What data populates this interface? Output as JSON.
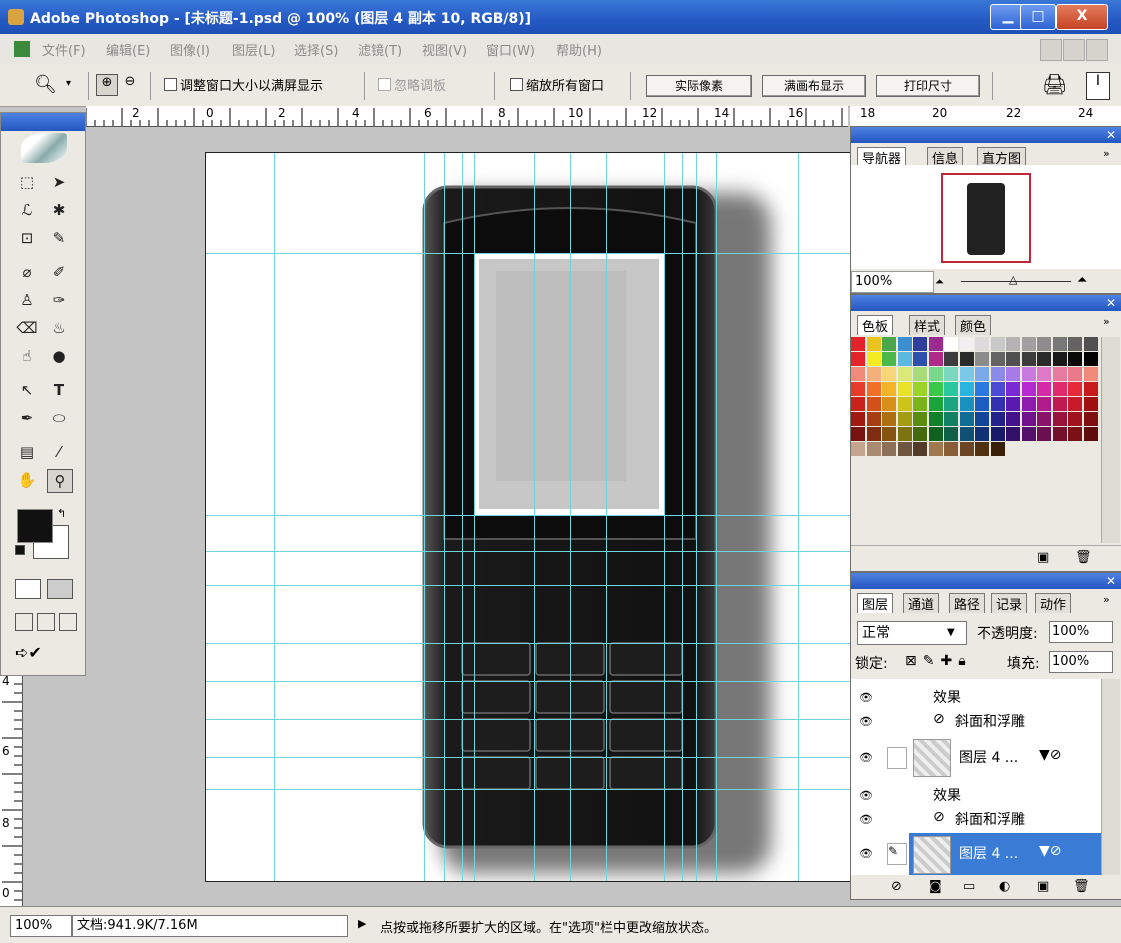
{
  "window": {
    "title": "Adobe Photoshop - [未标题-1.psd @ 100% (图层 4 副本 10, RGB/8)]",
    "minimize": "▁",
    "maximize": "□",
    "close": "X"
  },
  "menu": [
    "文件(F)",
    "编辑(E)",
    "图像(I)",
    "图层(L)",
    "选择(S)",
    "滤镜(T)",
    "视图(V)",
    "窗口(W)",
    "帮助(H)"
  ],
  "options": {
    "fit_window": "调整窗口大小以满屏显示",
    "ignore_palettes": "忽略调板",
    "zoom_all": "缩放所有窗口",
    "actual_pixels": "实际像素",
    "fit_screen": "满画布显示",
    "print_size": "打印尺寸"
  },
  "ruler": {
    "h_labels": [
      "2",
      "0",
      "2",
      "4",
      "6",
      "8",
      "10",
      "12",
      "14",
      "16",
      "18",
      "20",
      "22",
      "24"
    ],
    "v_labels": [
      "4",
      "6",
      "8",
      "0"
    ]
  },
  "navigator": {
    "tabs": [
      "导航器",
      "信息",
      "直方图"
    ],
    "zoom": "100%"
  },
  "swatches_panel": {
    "tabs": [
      "色板",
      "样式",
      "颜色"
    ]
  },
  "layers_panel": {
    "tabs": [
      "图层",
      "通道",
      "路径",
      "记录",
      "动作"
    ],
    "blend_mode": "正常",
    "opacity_label": "不透明度:",
    "opacity": "100%",
    "lock_label": "锁定:",
    "fill_label": "填充:",
    "fill": "100%",
    "rows": {
      "effects1": "效果",
      "bevel1": "斜面和浮雕",
      "layer1": "图层 4 ...",
      "effects2": "效果",
      "bevel2": "斜面和浮雕",
      "layer2": "图层 4 ..."
    }
  },
  "status": {
    "zoom": "100%",
    "doc": "文档:941.9K/7.16M",
    "hint": "点按或拖移所要扩大的区域。在\"选项\"栏中更改缩放状态。"
  },
  "colors": {
    "titlebar": "#2459c4",
    "guide": "#6fd6dd",
    "selected_layer": "#3a7bd5"
  }
}
